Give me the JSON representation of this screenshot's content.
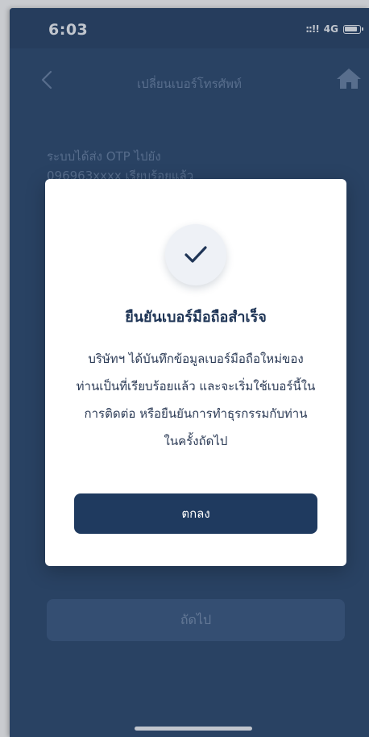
{
  "status_bar": {
    "time": "6:03",
    "signal": "::!!",
    "network": "4G"
  },
  "header": {
    "title": "เปลี่ยนเบอร์โทรศัพท์"
  },
  "background": {
    "otp_line_1": "ระบบได้ส่ง OTP ไปยัง",
    "otp_line_2": "096963xxxx เรียบร้อยแล้ว",
    "next_label": "ถัดไป"
  },
  "modal": {
    "title": "ยืนยันเบอร์มือถือสำเร็จ",
    "message_lines": [
      "บริษัทฯ ได้บันทึกข้อมูลเบอร์มือถือใหม่ของ",
      "ท่านเป็นที่เรียบร้อยแล้ว และจะเริ่มใช้เบอร์นี้ใน",
      "การติดต่อ หรือยืนยันการทำธุรกรรมกับท่าน",
      "ในครั้งถัดไป"
    ],
    "ok_label": "ตกลง"
  },
  "icons": {
    "back": "chevron-left-icon",
    "home": "home-icon",
    "check": "checkmark-icon",
    "battery": "battery-icon"
  },
  "colors": {
    "primary": "#1f3a5f",
    "background": "#2f4a6d",
    "modal": "#ffffff"
  }
}
